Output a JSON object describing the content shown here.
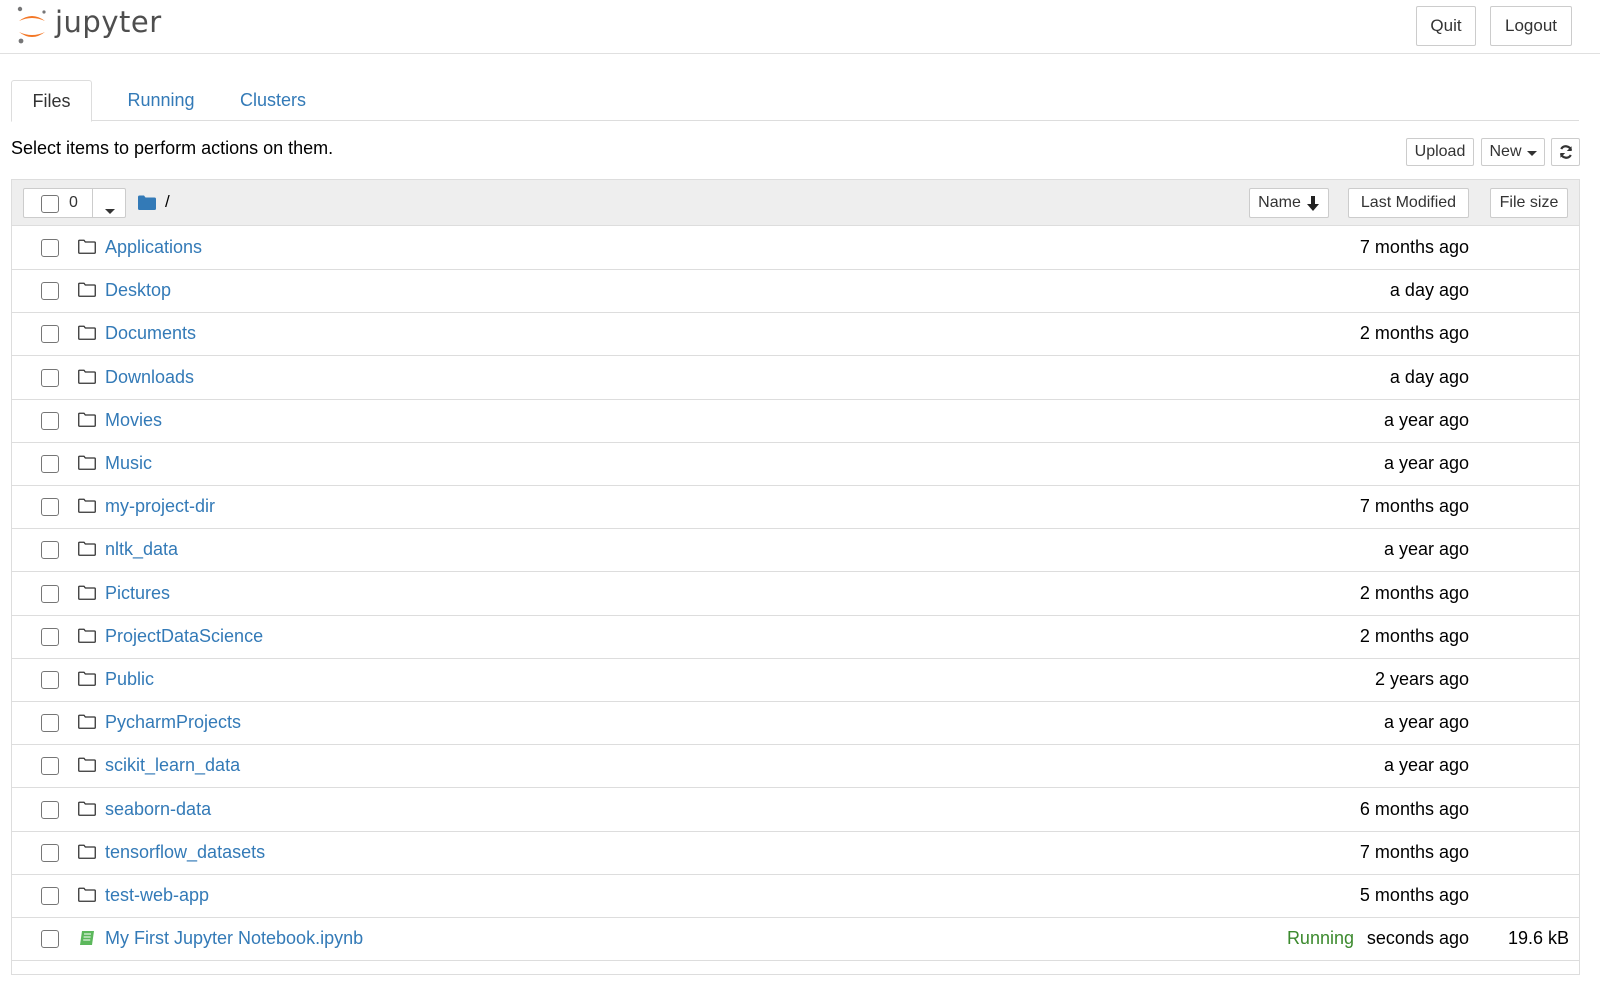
{
  "app": {
    "logo_text": "jupyter",
    "colors": {
      "logo_orange": "#f37726",
      "logo_grey": "#767677",
      "link": "#337ab7",
      "running": "#3c8a2e"
    }
  },
  "header": {
    "quit_label": "Quit",
    "logout_label": "Logout"
  },
  "tabs": [
    {
      "label": "Files",
      "active": true
    },
    {
      "label": "Running",
      "active": false
    },
    {
      "label": "Clusters",
      "active": false
    }
  ],
  "toolbar": {
    "instructions": "Select items to perform actions on them.",
    "upload_label": "Upload",
    "new_label": "New",
    "refresh_icon": "refresh-icon"
  },
  "list_header": {
    "selected_count": "0",
    "path": "/",
    "sort_name_label": "Name",
    "sort_modified_label": "Last Modified",
    "sort_size_label": "File size"
  },
  "items": [
    {
      "name": "Applications",
      "type": "folder",
      "modified": "7 months ago"
    },
    {
      "name": "Desktop",
      "type": "folder",
      "modified": "a day ago"
    },
    {
      "name": "Documents",
      "type": "folder",
      "modified": "2 months ago"
    },
    {
      "name": "Downloads",
      "type": "folder",
      "modified": "a day ago"
    },
    {
      "name": "Movies",
      "type": "folder",
      "modified": "a year ago"
    },
    {
      "name": "Music",
      "type": "folder",
      "modified": "a year ago"
    },
    {
      "name": "my-project-dir",
      "type": "folder",
      "modified": "7 months ago"
    },
    {
      "name": "nltk_data",
      "type": "folder",
      "modified": "a year ago"
    },
    {
      "name": "Pictures",
      "type": "folder",
      "modified": "2 months ago"
    },
    {
      "name": "ProjectDataScience",
      "type": "folder",
      "modified": "2 months ago"
    },
    {
      "name": "Public",
      "type": "folder",
      "modified": "2 years ago"
    },
    {
      "name": "PycharmProjects",
      "type": "folder",
      "modified": "a year ago"
    },
    {
      "name": "scikit_learn_data",
      "type": "folder",
      "modified": "a year ago"
    },
    {
      "name": "seaborn-data",
      "type": "folder",
      "modified": "6 months ago"
    },
    {
      "name": "tensorflow_datasets",
      "type": "folder",
      "modified": "7 months ago"
    },
    {
      "name": "test-web-app",
      "type": "folder",
      "modified": "5 months ago"
    },
    {
      "name": "My First Jupyter Notebook.ipynb",
      "type": "notebook",
      "modified": "seconds ago",
      "status": "Running",
      "size": "19.6 kB"
    }
  ]
}
